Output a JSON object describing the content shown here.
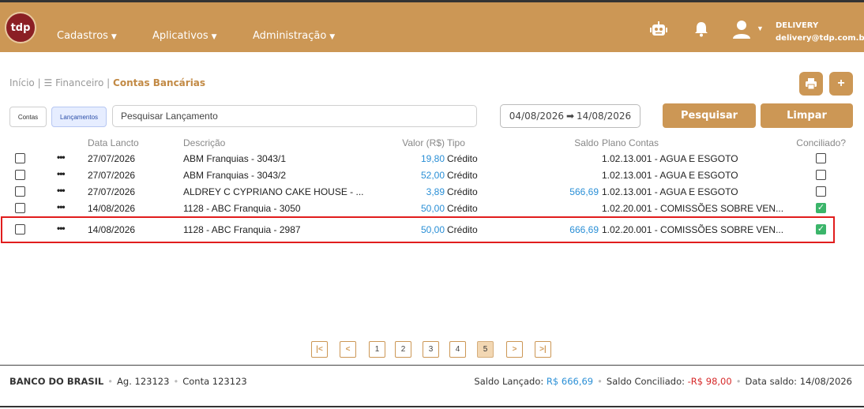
{
  "header": {
    "logo_text": "tdp",
    "menus": [
      {
        "label": "Cadastros"
      },
      {
        "label": "Aplicativos"
      },
      {
        "label": "Administração"
      }
    ],
    "user": {
      "name": "DELIVERY",
      "email": "delivery@tdp.com.br"
    },
    "icons": [
      "robot-icon",
      "bell-icon",
      "user-icon",
      "chevron-down-icon"
    ]
  },
  "breadcrumb": {
    "home": "Início",
    "separator": "|",
    "parent_icon": "☰",
    "parent": "Financeiro",
    "current": "Contas Bancárias"
  },
  "toolbar": {
    "tab_contas": "Contas",
    "tab_lancamentos": "Lançamentos",
    "search_placeholder": "Pesquisar Lançamento",
    "date_from": "04/08/2026",
    "date_to": "14/08/2026",
    "search_button": "Pesquisar",
    "clear_button": "Limpar"
  },
  "table": {
    "headers": {
      "data": "Data Lancto",
      "descricao": "Descrição",
      "valor": "Valor (R$)",
      "tipo": "Tipo",
      "saldo": "Saldo",
      "plano": "Plano Contas",
      "conciliado": "Conciliado?"
    },
    "rows": [
      {
        "data": "27/07/2026",
        "descricao": "ABM Franquias - 3043/1",
        "valor": "19,80",
        "tipo": "Crédito",
        "saldo": "",
        "plano": "1.02.13.001 - AGUA E ESGOTO",
        "conciliado": false
      },
      {
        "data": "27/07/2026",
        "descricao": "ABM Franquias - 3043/2",
        "valor": "52,00",
        "tipo": "Crédito",
        "saldo": "",
        "plano": "1.02.13.001 - AGUA E ESGOTO",
        "conciliado": false
      },
      {
        "data": "27/07/2026",
        "descricao": "ALDREY C CYPRIANO CAKE HOUSE - ...",
        "valor": "3,89",
        "tipo": "Crédito",
        "saldo": "566,69",
        "plano": "1.02.13.001 - AGUA E ESGOTO",
        "conciliado": false
      },
      {
        "data": "14/08/2026",
        "descricao": "1128 - ABC Franquia - 3050",
        "valor": "50,00",
        "tipo": "Crédito",
        "saldo": "",
        "plano": "1.02.20.001 - COMISSÕES SOBRE VEN...",
        "conciliado": true
      },
      {
        "data": "14/08/2026",
        "descricao": "1128 - ABC Franquia - 2987",
        "valor": "50,00",
        "tipo": "Crédito",
        "saldo": "666,69",
        "plano": "1.02.20.001 - COMISSÕES SOBRE VEN...",
        "conciliado": true
      }
    ],
    "row_menu_glyph": "•••",
    "check_glyph": "✓"
  },
  "pagination": {
    "first": "|<",
    "prev": "<",
    "pages": [
      "1",
      "2",
      "3",
      "4",
      "5"
    ],
    "current_page": "5",
    "next": ">",
    "last": ">|"
  },
  "footer": {
    "bank": "BANCO DO BRASIL",
    "agency": "Ag. 123123",
    "account": "Conta 123123",
    "saldo_lancado_label": "Saldo Lançado:",
    "saldo_lancado_value": "R$ 666,69",
    "saldo_conciliado_label": "Saldo Conciliado:",
    "saldo_conciliado_value": "-R$ 98,00",
    "data_saldo_label": "Data saldo:",
    "data_saldo_value": "14/08/2026",
    "separator": "•"
  },
  "colors": {
    "brand": "#cc9755",
    "logo_bg": "#8b1f24",
    "link_blue": "#2a8fd6",
    "negative": "#d62828",
    "checked": "#3bb56a",
    "highlight_border": "#e11d1d"
  }
}
